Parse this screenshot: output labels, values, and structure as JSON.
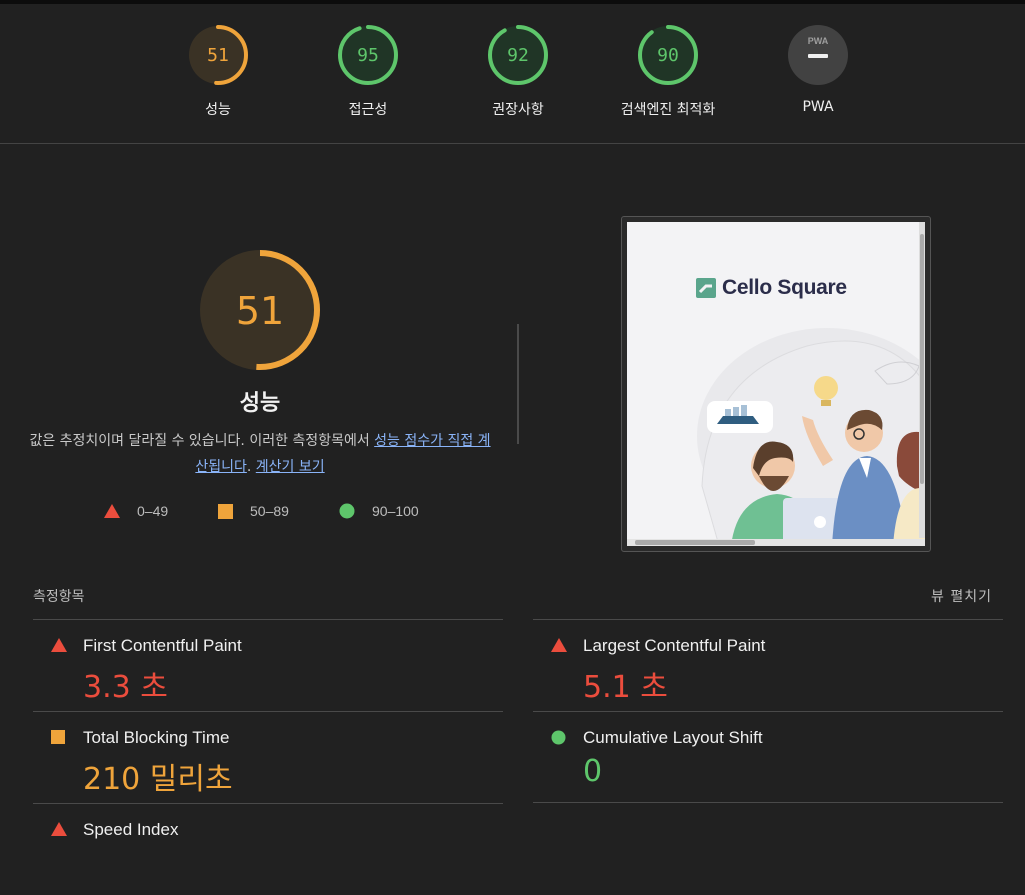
{
  "top_gauges": [
    {
      "score": "51",
      "label": "성능",
      "color": "#efa43b",
      "fraction": 0.51
    },
    {
      "score": "95",
      "label": "접근성",
      "color": "#5ec66b",
      "fraction": 0.95
    },
    {
      "score": "92",
      "label": "권장사항",
      "color": "#5ec66b",
      "fraction": 0.92
    },
    {
      "score": "90",
      "label": "검색엔진 최적화",
      "color": "#5ec66b",
      "fraction": 0.9
    },
    {
      "score": "PWA",
      "label": "PWA",
      "color": "#9e9e9e"
    }
  ],
  "performance": {
    "score": "51",
    "fraction": 0.51,
    "title": "성능",
    "desc_prefix": "값은 추정치이며 달라질 수 있습니다. 이러한 측정항목에서 ",
    "desc_link1": "성능 점수가 직접 계산됩니다",
    "desc_mid": ". ",
    "desc_link2": "계산기 보기"
  },
  "legend": [
    {
      "range": "0–49",
      "shape": "triangle",
      "color": "#eb4d3d"
    },
    {
      "range": "50–89",
      "shape": "square",
      "color": "#efa43b"
    },
    {
      "range": "90–100",
      "shape": "circle",
      "color": "#5ec66b"
    }
  ],
  "screenshot": {
    "brand": "Cello Square"
  },
  "metrics": {
    "heading": "측정항목",
    "toggle_label": "뷰 펼치기",
    "items": [
      {
        "name": "First Contentful Paint",
        "value": "3.3 초",
        "status": "red"
      },
      {
        "name": "Largest Contentful Paint",
        "value": "5.1 초",
        "status": "red"
      },
      {
        "name": "Total Blocking Time",
        "value": "210 밀리초",
        "status": "orange"
      },
      {
        "name": "Cumulative Layout Shift",
        "value": "0",
        "status": "green"
      },
      {
        "name": "Speed Index",
        "value": "",
        "status": "red"
      }
    ]
  },
  "colors": {
    "bad": "#eb4d3d",
    "average": "#efa43b",
    "good": "#5ec66b",
    "background": "#212121"
  }
}
